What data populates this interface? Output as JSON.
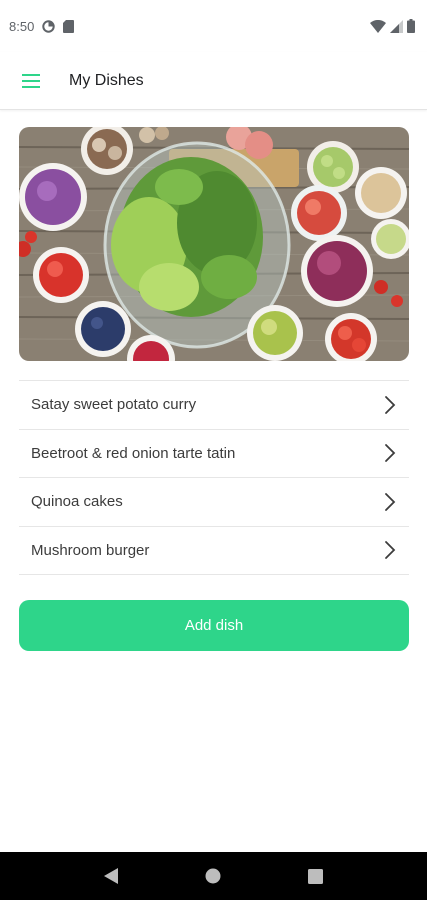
{
  "status_bar": {
    "time": "8:50"
  },
  "app_bar": {
    "title": "My Dishes",
    "menu_icon": "hamburger-menu-icon"
  },
  "hero": {
    "image": "salad-ingredients-photo"
  },
  "dishes": [
    {
      "name": "Satay sweet potato curry"
    },
    {
      "name": "Beetroot & red onion tarte tatin"
    },
    {
      "name": "Quinoa cakes"
    },
    {
      "name": "Mushroom burger"
    }
  ],
  "actions": {
    "add_dish_label": "Add dish"
  },
  "colors": {
    "accent": "#2ed58a",
    "text": "#202124"
  }
}
